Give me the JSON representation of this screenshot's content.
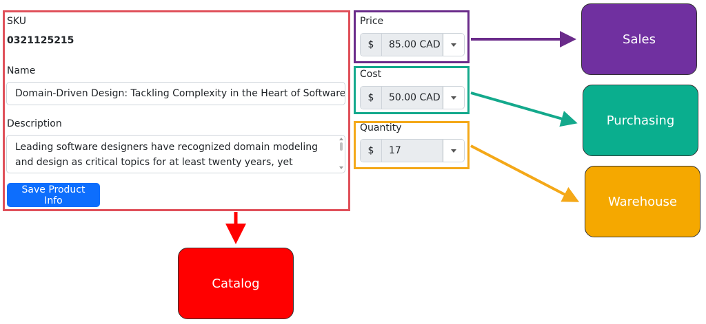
{
  "catalog": {
    "sku_label": "SKU",
    "sku_value": "0321125215",
    "name_label": "Name",
    "name_value": "Domain-Driven Design: Tackling Complexity in the Heart of Software",
    "description_label": "Description",
    "description_value": "Leading software designers have recognized domain modeling and design as critical topics for at least twenty years, yet surprisingly little",
    "save_button": "Save Product Info"
  },
  "price": {
    "label": "Price",
    "prefix": "$",
    "value": "85.00 CAD"
  },
  "cost": {
    "label": "Cost",
    "prefix": "$",
    "value": "50.00 CAD"
  },
  "quantity": {
    "label": "Quantity",
    "prefix": "$",
    "value": "17"
  },
  "contexts": {
    "sales": "Sales",
    "purchasing": "Purchasing",
    "warehouse": "Warehouse",
    "catalog": "Catalog"
  },
  "colors": {
    "catalog": "#ff0000",
    "catalog_frame": "#e0505a",
    "sales": "#7030a0",
    "purchasing": "#0aae8e",
    "warehouse": "#f5a800",
    "primary_button": "#0d6efd"
  }
}
